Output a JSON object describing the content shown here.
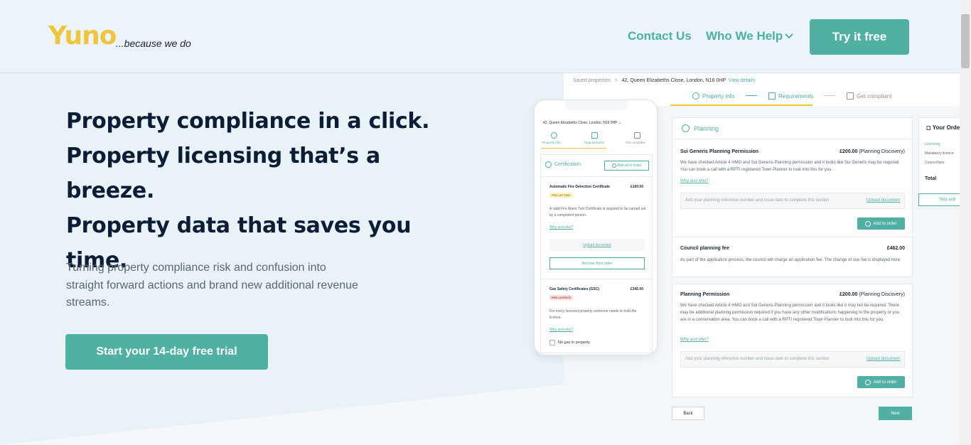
{
  "header": {
    "logo": "Yuno",
    "tagline": "...because we do",
    "nav": {
      "contact": "Contact Us",
      "who_we_help": "Who We Help"
    },
    "try_button": "Try it free"
  },
  "hero": {
    "headline": [
      "Property compliance in a click.",
      "Property licensing that’s a breeze.",
      "Property data that saves you",
      "time."
    ],
    "subtext": "Turning property compliance risk and confusion into straight forward actions and brand new additional revenue streams.",
    "cta": "Start your 14-day free trial"
  },
  "desktop": {
    "breadcrumb_root": "Saved properties",
    "breadcrumb_sep": ">",
    "breadcrumb_address": "42, Queen Elizabeths Close, London, N16 0HP",
    "view_details": "View details",
    "steps": [
      "Property info",
      "Requirements",
      "Get compliant"
    ],
    "planning_title": "Planning",
    "items": [
      {
        "title": "Sui Generis Planning Permission",
        "price": "£200.00",
        "price_note": "(Planning Discovery)",
        "text": "We have checked Article 4 HMO and Sui Generis Planning permission and it looks like Sui Generis may be required. You can book a call with a RPTI registered Town Planner to look into this for you.",
        "why": "Why and who?",
        "upload_placeholder": "Add your planning reference number and issue date to complete this section",
        "upload_link": "Upload document",
        "add_button": "Add to order"
      },
      {
        "title": "Council planning fee",
        "price": "£462.00",
        "text": "As part of the application process, the council will charge an application fee. The change of use fee is displayed here."
      },
      {
        "title": "Planning Permission",
        "price": "£200.00",
        "price_note": "(Planning Discovery)",
        "text": "We have checked Article 4 HMO and Sui Generis Planning permission and it looks like it may not be required. There may be additional planning permission required if you have any other modifications happening to the property or you are in a conservation area. You can book a call with a RPTI registered Town Planner to look into this for you.",
        "why": "Why and who?",
        "upload_placeholder": "Add your planning reference number and issue date to complete this section",
        "upload_link": "Upload document",
        "add_button": "Add to order"
      }
    ],
    "order": {
      "title": "Your Order",
      "lines": [
        "Licensing",
        "Mandatory licence",
        "Council fees"
      ],
      "total": "Total",
      "skip": "Skip and"
    },
    "back": "Back",
    "next": "Next"
  },
  "mobile": {
    "address": "42, Queen Elizabeths Close, London, N16 0HP",
    "steps": [
      "Property info",
      "Requirements",
      "Get compliant"
    ],
    "section": "Certification",
    "add_all": "Add all to order",
    "items": [
      {
        "title": "Automatic Fire Detection Certificate",
        "price": "£160.00",
        "badge": "PRE-LETTING",
        "text": "A valid Fire Alarm Test Certificate is required to be carried out by a competent person.",
        "why": "Why and who?",
        "upload": "Upload document",
        "remove": "Remove from order"
      },
      {
        "title": "Gas Safety Certificates (GSC)",
        "price": "£345.00",
        "badge": "PRE-LICENCE",
        "text": "For every licenced property someone needs to hold the license.",
        "why": "Why and who?",
        "checkbox": "No gas in property"
      }
    ]
  }
}
